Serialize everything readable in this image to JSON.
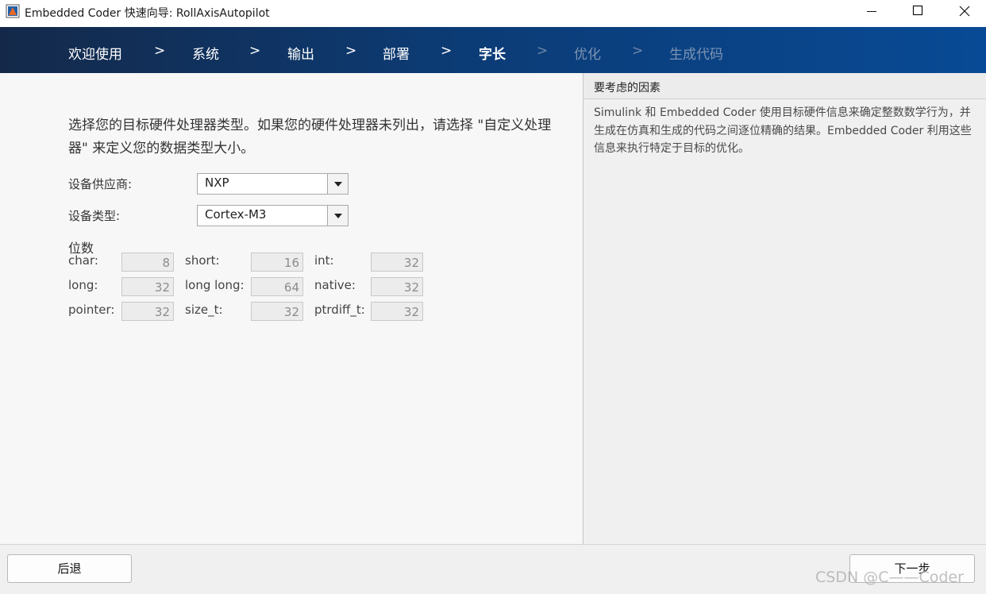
{
  "window": {
    "title": "Embedded Coder 快速向导: RollAxisAutopilot"
  },
  "steps": [
    {
      "label": "欢迎使用",
      "state": "done"
    },
    {
      "label": "系统",
      "state": "done"
    },
    {
      "label": "输出",
      "state": "done"
    },
    {
      "label": "部署",
      "state": "done"
    },
    {
      "label": "字长",
      "state": "active"
    },
    {
      "label": "优化",
      "state": "future"
    },
    {
      "label": "生成代码",
      "state": "future"
    }
  ],
  "step_separator": ">",
  "main": {
    "instruction": "选择您的目标硬件处理器类型。如果您的硬件处理器未列出，请选择 \"自定义处理器\" 来定义您的数据类型大小。",
    "vendor_label": "设备供应商:",
    "vendor_value": "NXP",
    "type_label": "设备类型:",
    "type_value": "Cortex-M3",
    "bits_title": "位数",
    "bits": {
      "char_label": "char:",
      "char_value": "8",
      "short_label": "short:",
      "short_value": "16",
      "int_label": "int:",
      "int_value": "32",
      "long_label": "long:",
      "long_value": "32",
      "longlong_label": "long long:",
      "longlong_value": "64",
      "native_label": "native:",
      "native_value": "32",
      "pointer_label": "pointer:",
      "pointer_value": "32",
      "sizet_label": "size_t:",
      "sizet_value": "32",
      "ptrdiff_label": "ptrdiff_t:",
      "ptrdiff_value": "32"
    }
  },
  "side": {
    "title": "要考虑的因素",
    "body": "Simulink 和 Embedded Coder 使用目标硬件信息来确定整数数学行为，并生成在仿真和生成的代码之间逐位精确的结果。Embedded Coder 利用这些信息来执行特定于目标的优化。"
  },
  "footer": {
    "back_label": "后退",
    "next_label": "下一步",
    "watermark": "CSDN @C——Coder"
  },
  "colors": {
    "nav_dark": "#14294a",
    "nav_light": "#084a95",
    "future_step": "#7d93b3"
  }
}
